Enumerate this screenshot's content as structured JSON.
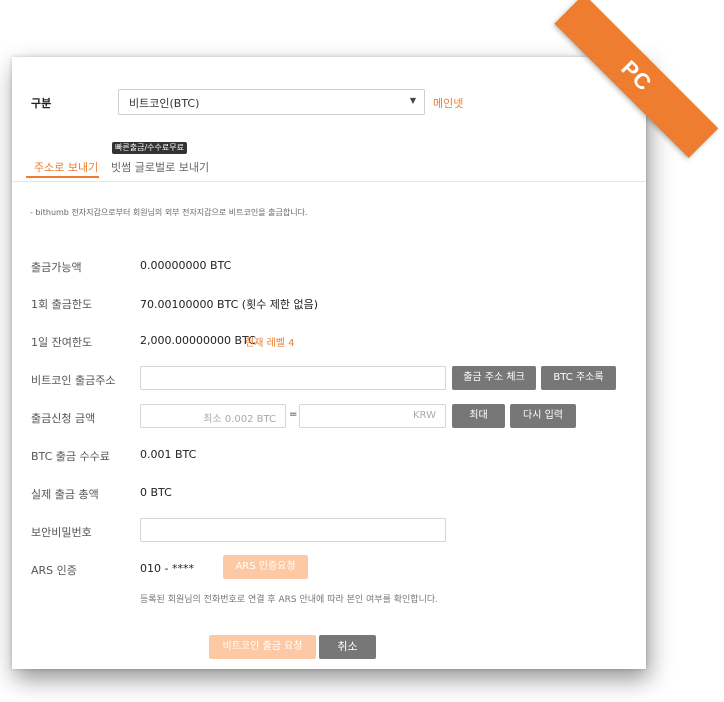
{
  "ribbon": {
    "label": "PC"
  },
  "category": {
    "label": "구분",
    "selected": "비트코인(BTC)",
    "network": "메인넷"
  },
  "tabs": [
    {
      "label": "주소로 보내기"
    },
    {
      "label": "빗썸 글로벌로 보내기",
      "badge": "빠른출금/수수료무료"
    }
  ],
  "notice": "- bithumb 전자지갑으로부터 회원님의 외부 전자지갑으로 비트코인을 출금합니다.",
  "fields": {
    "available": {
      "label": "출금가능액",
      "value": "0.00000000 BTC"
    },
    "per_limit": {
      "label": "1회 출금한도",
      "value": "70.00100000 BTC (횟수 제한 없음)"
    },
    "daily_remaining": {
      "label": "1일 잔여한도",
      "value": "2,000.00000000 BTC",
      "level": "현재 레벨 4"
    },
    "address": {
      "label": "비트코인 출금주소",
      "check_btn": "출금 주소 체크",
      "book_btn": "BTC 주소록"
    },
    "amount": {
      "label": "출금신청 금액",
      "btc_placeholder": "최소 0.002 BTC",
      "equals": "=",
      "krw_placeholder": "KRW",
      "max_btn": "최대",
      "reset_btn": "다시 입력"
    },
    "fee": {
      "label": "BTC 출금 수수료",
      "value": "0.001 BTC"
    },
    "total": {
      "label": "실제 출금 총액",
      "value": "0 BTC"
    },
    "password": {
      "label": "보안비밀번호"
    },
    "ars": {
      "label": "ARS 인증",
      "phone": "010 - ****",
      "request_btn": "ARS 인증요청",
      "note": "등록된 회원님의 전화번호로 연결 후 ARS 안내에 따라 본인 여부를 확인합니다."
    }
  },
  "actions": {
    "submit": "비트코인 출금 요청",
    "cancel": "취소"
  }
}
